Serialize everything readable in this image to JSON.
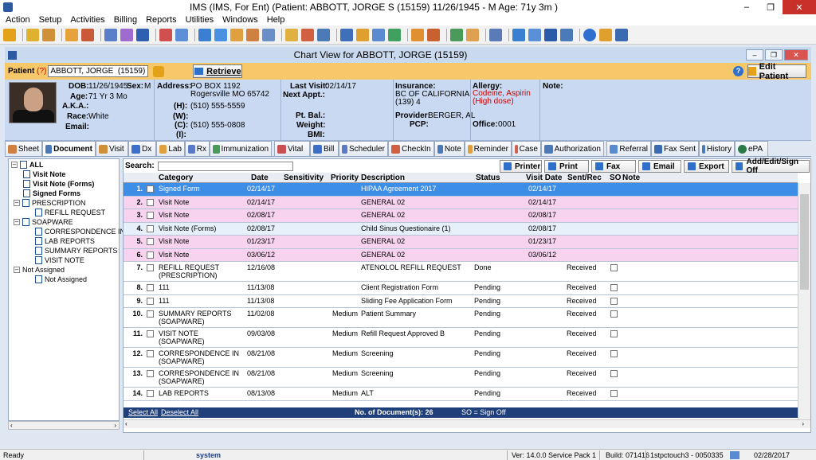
{
  "app": {
    "title": "IMS (IMS, For Ent)    (Patient: ABBOTT, JORGE S (15159) 11/26/1945 - M Age: 71y 3m )"
  },
  "menu": [
    "Action",
    "Setup",
    "Activities",
    "Billing",
    "Reports",
    "Utilities",
    "Windows",
    "Help"
  ],
  "child_window": {
    "title": "Chart View for ABBOTT, JORGE  (15159)"
  },
  "patient_bar": {
    "label": "Patient",
    "label_marker": "(?)",
    "value": "ABBOTT, JORGE  (15159)",
    "retrieve_label": "Retrieve",
    "edit_patient_label": "Edit Patient"
  },
  "info": {
    "dob_label": "DOB:",
    "dob": "11/26/1945",
    "sex_label": "Sex:",
    "sex": "M",
    "age_label": "Age:",
    "age": "71 Yr 3 Mo",
    "aka_label": "A.K.A.:",
    "race_label": "Race:",
    "race": "White",
    "email_label": "Email:",
    "address_label": "Address:",
    "address1": "PO BOX 1192",
    "address2": "Rogersville  MO  65742",
    "h_label": "(H):",
    "h_phone": "(510) 555-5559",
    "w_label": "(W):",
    "c_label": "(C):",
    "c_phone": "(510) 555-0808",
    "i_label": "(I):",
    "last_visit_label": "Last Visit:",
    "last_visit": "02/14/17",
    "next_appt_label": "Next Appt.:",
    "pt_bal_label": "Pt. Bal.:",
    "weight_label": "Weight:",
    "bmi_label": "BMI:",
    "insurance_label": "Insurance:",
    "insurance1": "BC OF CALIFORNIA",
    "insurance2": "(139)    4",
    "provider_label": "Provider:",
    "provider": "BERGER, AL",
    "pcp_label": "PCP:",
    "allergy_label": "Allergy:",
    "allergy": "Codeine, Aspirin (High dose)",
    "office_label": "Office:",
    "office": "0001",
    "note_label": "Note:"
  },
  "tabs": [
    "Sheet",
    "Document",
    "Visit",
    "Dx",
    "Lab",
    "Rx",
    "Immunization",
    "Vital",
    "Bill",
    "Scheduler",
    "CheckIn",
    "Note",
    "Reminder",
    "Case",
    "Authorization",
    "Referral",
    "Fax Sent",
    "History",
    "ePA"
  ],
  "tree": {
    "items": [
      {
        "label": "ALL",
        "bold": true
      },
      {
        "label": "Visit Note",
        "bold": true
      },
      {
        "label": "Visit Note (Forms)",
        "bold": true
      },
      {
        "label": "Signed Forms",
        "bold": true
      },
      {
        "label": "PRESCRIPTION",
        "bold": false
      },
      {
        "label": "REFILL REQUEST",
        "bold": false
      },
      {
        "label": "SOAPWARE",
        "bold": false
      },
      {
        "label": "CORRESPONDENCE IN",
        "bold": false
      },
      {
        "label": "LAB REPORTS",
        "bold": false
      },
      {
        "label": "SUMMARY REPORTS",
        "bold": false
      },
      {
        "label": "VISIT NOTE",
        "bold": false
      },
      {
        "label": "Not Assigned",
        "bold": false
      },
      {
        "label": "Not Assigned",
        "bold": false
      }
    ]
  },
  "search": {
    "label": "Search:",
    "value": ""
  },
  "actions": [
    "Printer",
    "Print",
    "Fax",
    "Email",
    "Export",
    "Add/Edit/Sign Off"
  ],
  "columns": [
    "Category",
    "Date",
    "Sensitivity",
    "Priority",
    "Description",
    "Status",
    "Visit Date",
    "Sent/Rec",
    "SO",
    "Note"
  ],
  "rows": [
    {
      "n": "1.",
      "category": "Signed Form",
      "date": "02/14/17",
      "sensitivity": "",
      "priority": "",
      "description": "HIPAA Agreement 2017",
      "status": "",
      "visit_date": "02/14/17",
      "sent_rec": "",
      "so": false,
      "style": "selected"
    },
    {
      "n": "2.",
      "category": "Visit Note",
      "date": "02/14/17",
      "sensitivity": "",
      "priority": "",
      "description": "GENERAL 02",
      "status": "",
      "visit_date": "02/14/17",
      "sent_rec": "",
      "so": false,
      "style": "pink"
    },
    {
      "n": "3.",
      "category": "Visit Note",
      "date": "02/08/17",
      "sensitivity": "",
      "priority": "",
      "description": "GENERAL 02",
      "status": "",
      "visit_date": "02/08/17",
      "sent_rec": "",
      "so": false,
      "style": "pink"
    },
    {
      "n": "4.",
      "category": "Visit Note (Forms)",
      "date": "02/08/17",
      "sensitivity": "",
      "priority": "",
      "description": "Child Sinus Questionaire (1)",
      "status": "",
      "visit_date": "02/08/17",
      "sent_rec": "",
      "so": false,
      "style": "blue"
    },
    {
      "n": "5.",
      "category": "Visit Note",
      "date": "01/23/17",
      "sensitivity": "",
      "priority": "",
      "description": "GENERAL 02",
      "status": "",
      "visit_date": "01/23/17",
      "sent_rec": "",
      "so": false,
      "style": "pink"
    },
    {
      "n": "6.",
      "category": "Visit Note",
      "date": "03/06/12",
      "sensitivity": "",
      "priority": "",
      "description": "GENERAL 02",
      "status": "",
      "visit_date": "03/06/12",
      "sent_rec": "",
      "so": false,
      "style": "pink"
    },
    {
      "n": "7.",
      "category": "REFILL REQUEST\n(PRESCRIPTION)",
      "date": "12/16/08",
      "sensitivity": "",
      "priority": "",
      "description": "ATENOLOL REFILL REQUEST",
      "status": "Done",
      "visit_date": "",
      "sent_rec": "Received",
      "so": true,
      "style": "white"
    },
    {
      "n": "8.",
      "category": "111",
      "date": "11/13/08",
      "sensitivity": "",
      "priority": "",
      "description": "Client Registration Form",
      "status": "Pending",
      "visit_date": "",
      "sent_rec": "Received",
      "so": true,
      "style": "white"
    },
    {
      "n": "9.",
      "category": "111",
      "date": "11/13/08",
      "sensitivity": "",
      "priority": "",
      "description": "Sliding Fee Application Form",
      "status": "Pending",
      "visit_date": "",
      "sent_rec": "Received",
      "so": true,
      "style": "white"
    },
    {
      "n": "10.",
      "category": "SUMMARY REPORTS\n(SOAPWARE)",
      "date": "11/02/08",
      "sensitivity": "",
      "priority": "Medium",
      "description": "Patient Summary",
      "status": "Pending",
      "visit_date": "",
      "sent_rec": "Received",
      "so": true,
      "style": "white"
    },
    {
      "n": "11.",
      "category": "VISIT NOTE\n(SOAPWARE)",
      "date": "09/03/08",
      "sensitivity": "",
      "priority": "Medium",
      "description": "Refill Request Approved B",
      "status": "Pending",
      "visit_date": "",
      "sent_rec": "Received",
      "so": true,
      "style": "white"
    },
    {
      "n": "12.",
      "category": "CORRESPONDENCE IN\n(SOAPWARE)",
      "date": "08/21/08",
      "sensitivity": "",
      "priority": "Medium",
      "description": "Screening",
      "status": "Pending",
      "visit_date": "",
      "sent_rec": "Received",
      "so": true,
      "style": "white"
    },
    {
      "n": "13.",
      "category": "CORRESPONDENCE IN\n(SOAPWARE)",
      "date": "08/21/08",
      "sensitivity": "",
      "priority": "Medium",
      "description": "Screening",
      "status": "Pending",
      "visit_date": "",
      "sent_rec": "Received",
      "so": true,
      "style": "white"
    },
    {
      "n": "14.",
      "category": "LAB REPORTS",
      "date": "08/13/08",
      "sensitivity": "",
      "priority": "Medium",
      "description": "ALT",
      "status": "Pending",
      "visit_date": "",
      "sent_rec": "Received",
      "so": true,
      "style": "white"
    }
  ],
  "footer": {
    "select_all": "Select All",
    "deselect_all": "Deselect All",
    "count": "No. of Document(s): 26",
    "so_legend": "SO = Sign Off"
  },
  "status": {
    "left": "Ready",
    "user": "system",
    "version": "Ver: 14.0.0 Service Pack 1",
    "build": "Build: 071416",
    "server": "1stpctouch3 - 0050335",
    "date": "02/28/2017"
  },
  "colors": {
    "selected": "#3d8ee6",
    "pink": "#f8d3f0",
    "blue": "#e6f0fb",
    "white": "#ffffff",
    "accent": "#1f3f7a"
  }
}
